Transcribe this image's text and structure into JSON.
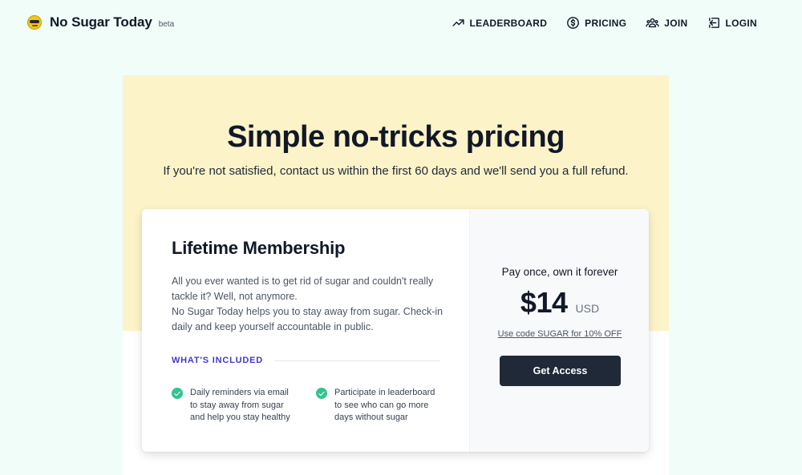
{
  "brand": {
    "name": "No Sugar Today",
    "badge": "beta",
    "logo_icon": "sunglasses-emoji-icon"
  },
  "nav": {
    "items": [
      {
        "label": "LEADERBOARD",
        "icon": "trending-up-icon"
      },
      {
        "label": "PRICING",
        "icon": "dollar-circle-icon"
      },
      {
        "label": "JOIN",
        "icon": "users-icon"
      },
      {
        "label": "LOGIN",
        "icon": "login-icon"
      }
    ]
  },
  "hero": {
    "title": "Simple no-tricks pricing",
    "subtitle": "If you're not satisfied, contact us within the first 60 days and we'll send you a full refund."
  },
  "plan": {
    "title": "Lifetime Membership",
    "description": [
      "All you ever wanted is to get rid of sugar and couldn't really tackle it? Well, not anymore.",
      "No Sugar Today helps you to stay away from sugar. Check-in daily and keep yourself accountable in public."
    ],
    "included_label": "WHAT'S INCLUDED",
    "features": [
      "Daily reminders via email to stay away from sugar and help you stay healthy",
      "Participate in leaderboard to see who can go more days without sugar"
    ]
  },
  "pricing": {
    "tagline": "Pay once, own it forever",
    "price": "$14",
    "currency": "USD",
    "coupon": "Use code SUGAR for 10% OFF",
    "cta": "Get Access"
  },
  "colors": {
    "page_bg": "#f0fdf8",
    "band_bg": "#fdf3c8",
    "accent": "#4338ca",
    "check": "#34c38f",
    "cta_bg": "#1f2937"
  }
}
